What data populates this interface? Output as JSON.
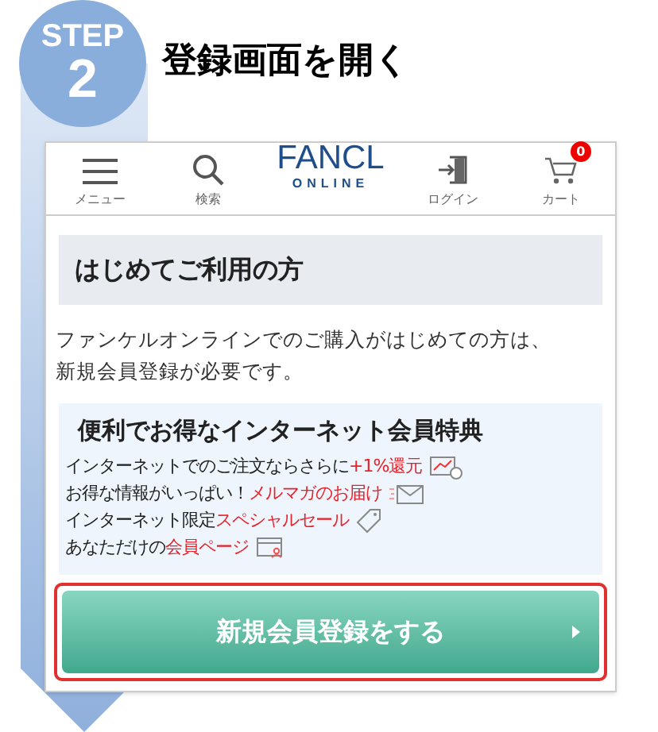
{
  "step": {
    "label": "STEP",
    "number": "2"
  },
  "title": "登録画面を開く",
  "header": {
    "nav": [
      {
        "kind": "menu",
        "label": "メニュー"
      },
      {
        "kind": "search",
        "label": "検索"
      },
      {
        "kind": "logo",
        "label": "FANCL",
        "sub": "ONLINE"
      },
      {
        "kind": "login",
        "label": "ログイン"
      },
      {
        "kind": "cart",
        "label": "カート",
        "badge": "0"
      }
    ]
  },
  "section_title": "はじめてご利用の方",
  "intro": [
    "ファンケルオンラインでのご購入がはじめての方は、",
    "新規会員登録が必要です。"
  ],
  "benefits": {
    "title": "便利でお得なインターネット会員特典",
    "items": [
      {
        "kind": "points",
        "lead": "インターネットでのご注文ならさらに",
        "highlight": "+1%還元"
      },
      {
        "kind": "mail",
        "lead": "お得な情報がいっぱい！",
        "highlight": "メルマガのお届け"
      },
      {
        "kind": "tag",
        "lead": "インターネット限定",
        "highlight": "スペシャルセール"
      },
      {
        "kind": "page",
        "lead": "あなただけの",
        "highlight": "会員ページ"
      }
    ]
  },
  "register_button": {
    "label": "新規会員登録をする",
    "highlighted": true
  }
}
